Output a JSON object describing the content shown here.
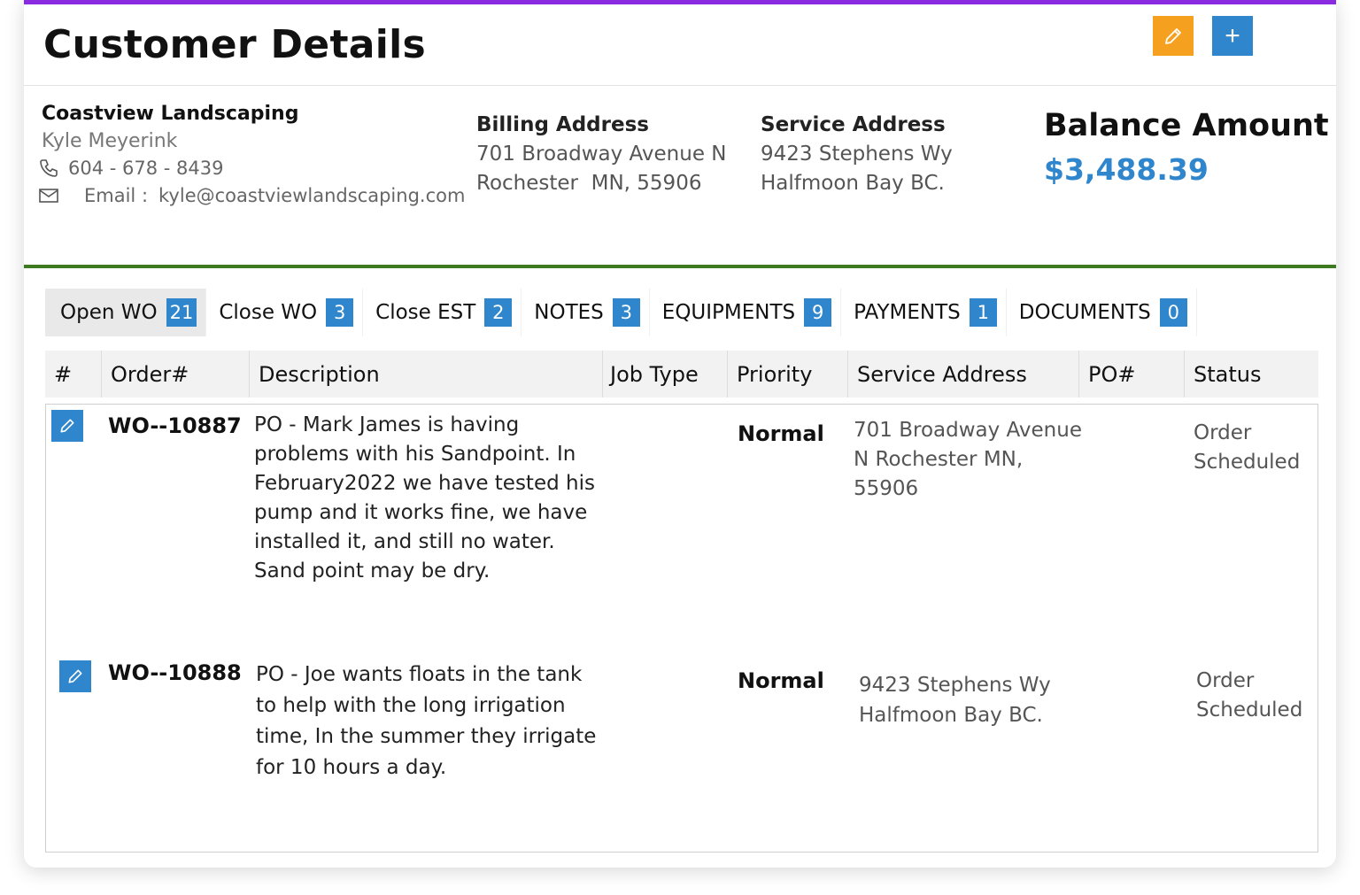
{
  "header": {
    "title": "Customer Details",
    "edit_button_icon": "pencil-icon",
    "add_button_label": "+"
  },
  "customer": {
    "company": "Coastview Landscaping",
    "contact_name": "Kyle Meyerink",
    "phone": "604 - 678 - 8439",
    "email_label": "Email :",
    "email": "kyle@coastviewlandscaping.com"
  },
  "billing": {
    "title": "Billing Address",
    "line1": "701 Broadway Avenue N",
    "line2": "Rochester  MN, 55906"
  },
  "service": {
    "title": "Service Address",
    "line1": "9423 Stephens Wy",
    "line2": "Halfmoon Bay BC."
  },
  "balance": {
    "title": "Balance Amount",
    "amount": "$3,488.39"
  },
  "tabs": [
    {
      "label": "Open WO",
      "count": "21"
    },
    {
      "label": "Close WO",
      "count": "3"
    },
    {
      "label": "Close EST",
      "count": "2"
    },
    {
      "label": "NOTES",
      "count": "3"
    },
    {
      "label": "EQUIPMENTS",
      "count": "9"
    },
    {
      "label": "PAYMENTS",
      "count": "1"
    },
    {
      "label": "DOCUMENTS",
      "count": "0"
    }
  ],
  "table": {
    "columns": [
      "#",
      "Order#",
      "Description",
      "Job Type",
      "Priority",
      "Service Address",
      "PO#",
      "Status"
    ],
    "rows": [
      {
        "order": "WO--10887",
        "description": "PO - Mark James is having problems with his Sandpoint. In February2022 we have tested his pump and it works fine, we have installed it, and still no water. Sand point may be dry.",
        "job_type": "",
        "priority": "Normal",
        "service_address": "701 Broadway Avenue N  Rochester  MN, 55906",
        "po": "",
        "status": "Order Scheduled"
      },
      {
        "order": "WO--10888",
        "description": "PO - Joe wants floats in the tank to help with the long irrigation time, In the summer they irrigate for 10 hours a day.",
        "job_type": "",
        "priority": "Normal",
        "service_address": "9423 Stephens Wy Halfmoon Bay BC.",
        "po": "",
        "status": "Order Scheduled"
      }
    ]
  },
  "colors": {
    "accent_purple": "#8a2be2",
    "accent_green": "#3f7a1f",
    "primary_blue": "#2f86cc",
    "edit_orange": "#f5a11f"
  }
}
